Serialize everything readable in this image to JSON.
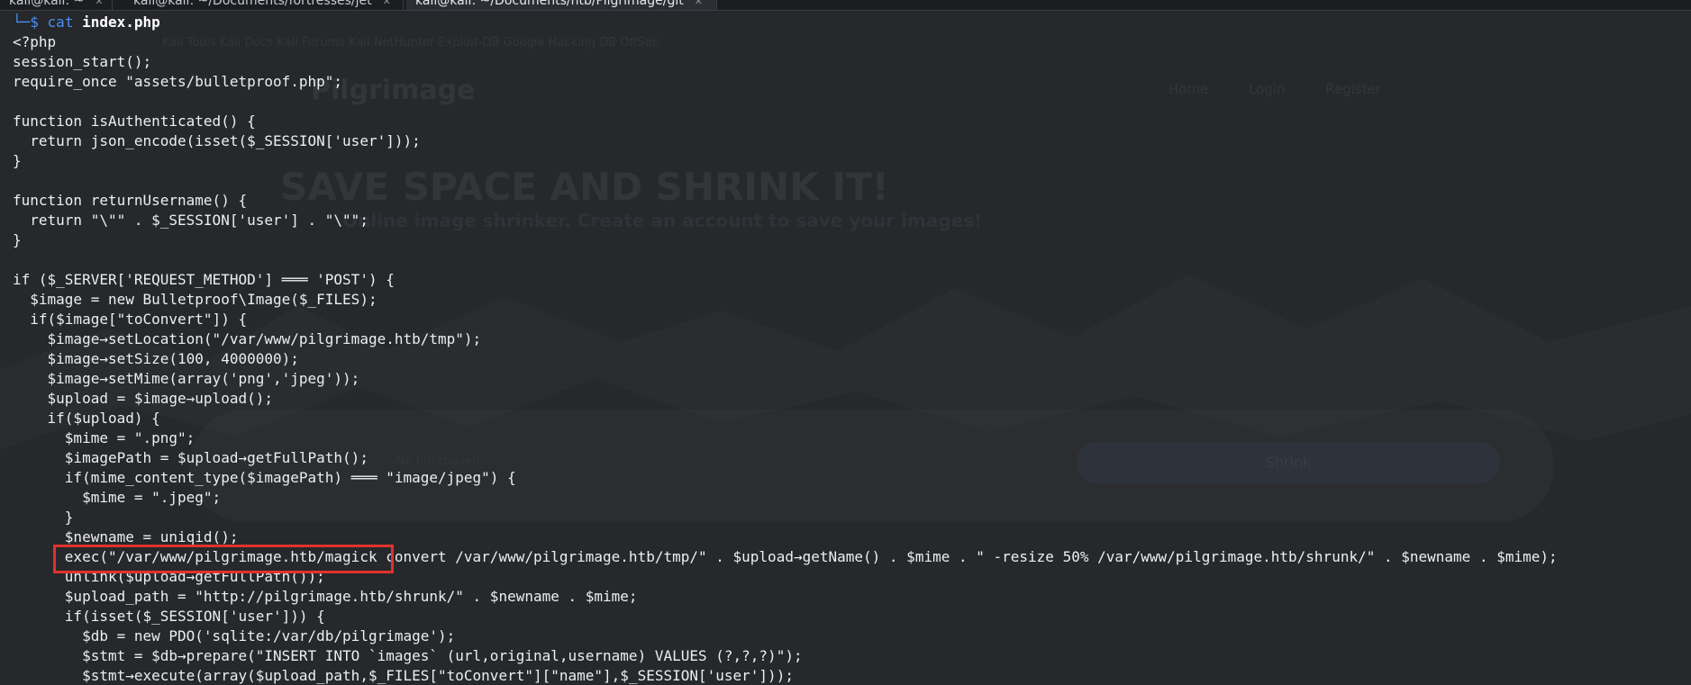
{
  "tabs": [
    {
      "label": "kali@kali: ~",
      "close": "✕"
    },
    {
      "label": "kali@kali: ~/Documents/fortresses/jet",
      "close": "✕"
    },
    {
      "label": "kali@kali: ~/Documents/htb/Pilgrimage/git",
      "close": "✕"
    }
  ],
  "prompt": {
    "corner": "└─",
    "dollar": "$",
    "command": "cat",
    "argument": "index.php"
  },
  "code_lines": [
    "<?php",
    "session_start();",
    "require_once \"assets/bulletproof.php\";",
    "",
    "function isAuthenticated() {",
    "  return json_encode(isset($_SESSION['user']));",
    "}",
    "",
    "function returnUsername() {",
    "  return \"\\\"\" . $_SESSION['user'] . \"\\\"\";",
    "}",
    "",
    "if ($_SERVER['REQUEST_METHOD'] ═══ 'POST') {",
    "  $image = new Bulletproof\\Image($_FILES);",
    "  if($image[\"toConvert\"]) {",
    "    $image→setLocation(\"/var/www/pilgrimage.htb/tmp\");",
    "    $image→setSize(100, 4000000);",
    "    $image→setMime(array('png','jpeg'));",
    "    $upload = $image→upload();",
    "    if($upload) {",
    "      $mime = \".png\";",
    "      $imagePath = $upload→getFullPath();",
    "      if(mime_content_type($imagePath) ═══ \"image/jpeg\") {",
    "        $mime = \".jpeg\";",
    "      }",
    "      $newname = uniqid();",
    "      exec(\"/var/www/pilgrimage.htb/magick convert /var/www/pilgrimage.htb/tmp/\" . $upload→getName() . $mime . \" -resize 50% /var/www/pilgrimage.htb/shrunk/\" . $newname . $mime);",
    "      unlink($upload→getFullPath());",
    "      $upload_path = \"http://pilgrimage.htb/shrunk/\" . $newname . $mime;",
    "      if(isset($_SESSION['user'])) {",
    "        $db = new PDO('sqlite:/var/db/pilgrimage');",
    "        $stmt = $db→prepare(\"INSERT INTO `images` (url,original,username) VALUES (?,?,?)\");",
    "        $stmt→execute(array($upload_path,$_FILES[\"toConvert\"][\"name\"],$_SESSION['user']));"
  ],
  "background_page": {
    "bookmarks": "Kali Tools   Kali Docs   Kali Forums   Kali NetHunter   Exploit-DB   Google Hacking DB   OffSec",
    "brand": "Pilgrimage",
    "nav": [
      "Home",
      "Login",
      "Register"
    ],
    "hero_title": "SAVE SPACE AND SHRINK IT!",
    "hero_subtitle": "Online image shrinker. Create an account to save your images!",
    "file_status": "No file chosen",
    "shrink_button": "Shrink"
  },
  "colors": {
    "terminal_bg": "#26282c",
    "text": "#eceef2",
    "prompt": "#4a8ef0",
    "highlight": "#e0322e"
  }
}
